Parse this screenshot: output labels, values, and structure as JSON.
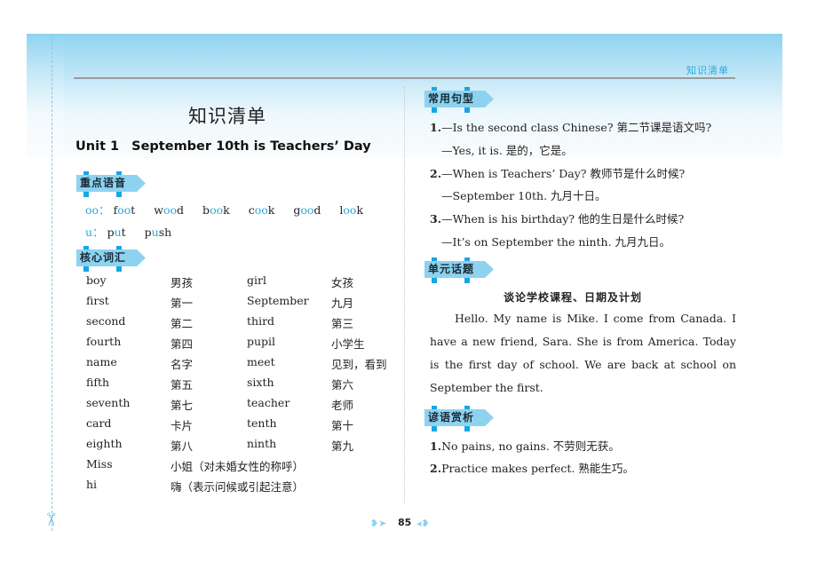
{
  "header": {
    "running_head": "知识清单"
  },
  "left": {
    "title": "知识清单",
    "unit_label": "Unit 1",
    "unit_title": "September 10th is Teachers’ Day",
    "sections": {
      "pronunciation": "重点语音",
      "vocabulary": "核心词汇"
    },
    "pronunciation": [
      {
        "label": "oo",
        "sep": "：",
        "words": [
          {
            "pre": "f",
            "hl": "oo",
            "post": "t"
          },
          {
            "pre": "w",
            "hl": "oo",
            "post": "d"
          },
          {
            "pre": "b",
            "hl": "oo",
            "post": "k"
          },
          {
            "pre": "c",
            "hl": "oo",
            "post": "k"
          },
          {
            "pre": "g",
            "hl": "oo",
            "post": "d"
          },
          {
            "pre": "l",
            "hl": "oo",
            "post": "k"
          }
        ]
      },
      {
        "label": "u",
        "sep": "：",
        "words": [
          {
            "pre": "p",
            "hl": "u",
            "post": "t"
          },
          {
            "pre": "p",
            "hl": "u",
            "post": "sh"
          }
        ]
      }
    ],
    "vocabulary": [
      [
        "boy",
        "男孩",
        "girl",
        "女孩"
      ],
      [
        "first",
        "第一",
        "September",
        "九月"
      ],
      [
        "second",
        "第二",
        "third",
        "第三"
      ],
      [
        "fourth",
        "第四",
        "pupil",
        "小学生"
      ],
      [
        "name",
        "名字",
        "meet",
        "见到，看到"
      ],
      [
        "fifth",
        "第五",
        "sixth",
        "第六"
      ],
      [
        "seventh",
        "第七",
        "teacher",
        "老师"
      ],
      [
        "card",
        "卡片",
        "tenth",
        "第十"
      ],
      [
        "eighth",
        "第八",
        "ninth",
        "第九"
      ],
      [
        "Miss",
        "小姐（对未婚女性的称呼）",
        "",
        ""
      ],
      [
        "hi",
        "嗨（表示问候或引起注意）",
        "",
        ""
      ]
    ]
  },
  "right": {
    "sections": {
      "sentences": "常用句型",
      "topic": "单元话题",
      "proverbs": "谚语赏析"
    },
    "sentences": [
      {
        "num": "1.",
        "q": "—Is the second class Chinese? 第二节课是语文吗?",
        "a": "—Yes, it is. 是的，它是。"
      },
      {
        "num": "2.",
        "q": "—When is Teachers’ Day? 教师节是什么时候?",
        "a": "—September 10th. 九月十日。"
      },
      {
        "num": "3.",
        "q": "—When is his birthday? 他的生日是什么时候?",
        "a": "—It’s on September the ninth. 九月九日。"
      }
    ],
    "topic_title": "谈论学校课程、日期及计划",
    "topic_lines": [
      "Hello.  My name is Mike.  I come from Canada.  I",
      "have a new friend, Sara.  She is from America.  Today",
      "is the first day of school.  We are back at school on",
      "September the first."
    ],
    "proverbs": [
      {
        "num": "1.",
        "text": "No pains, no gains. 不劳则无获。"
      },
      {
        "num": "2.",
        "text": "Practice makes perfect. 熟能生巧。"
      }
    ]
  },
  "footer": {
    "page_number": "85",
    "left_ornament": "bird-ornament",
    "right_ornament": "bird-ornament"
  },
  "margin": {
    "cut_icon": "scissors-icon"
  },
  "colors": {
    "accent": "#2aa8d8",
    "tag_fill": "#8dd3f0",
    "tag_peg": "#17a6e4",
    "header_top": "#8fd3f1"
  }
}
